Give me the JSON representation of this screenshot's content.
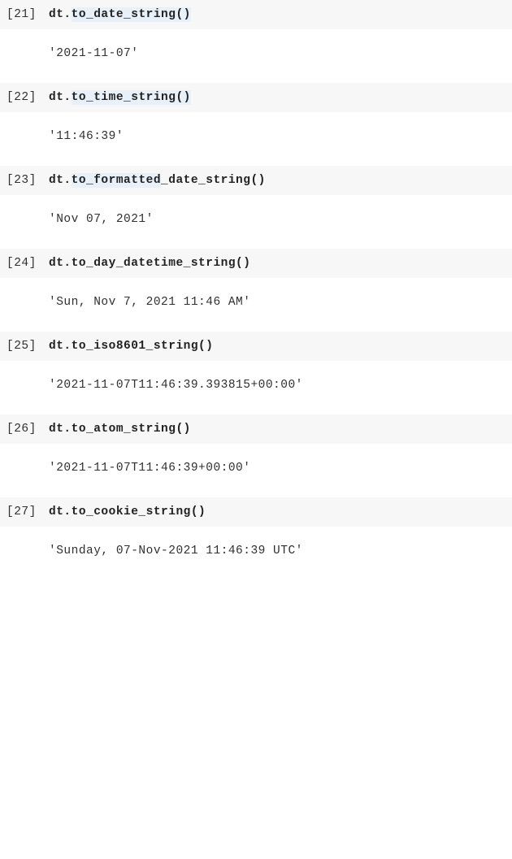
{
  "cells": [
    {
      "prompt": "[21] ",
      "code_prefix": "dt.",
      "code_highlight": "to_date_string()",
      "code_suffix": "",
      "output": "'2021-11-07'"
    },
    {
      "prompt": "[22] ",
      "code_prefix": "dt.",
      "code_highlight": "to_time_string()",
      "code_suffix": "",
      "output": "'11:46:39'"
    },
    {
      "prompt": "[23] ",
      "code_prefix": "dt.",
      "code_highlight": "to_formatted",
      "code_suffix": "_date_string()",
      "output": "'Nov 07, 2021'"
    },
    {
      "prompt": "[24] ",
      "code_prefix": "dt.to_day_datetime_string()",
      "code_highlight": "",
      "code_suffix": "",
      "output": "'Sun, Nov 7, 2021 11:46 AM'"
    },
    {
      "prompt": "[25] ",
      "code_prefix": "dt.to_iso8601_string()",
      "code_highlight": "",
      "code_suffix": "",
      "output": "'2021-11-07T11:46:39.393815+00:00'"
    },
    {
      "prompt": "[26] ",
      "code_prefix": "dt.to_atom_string()",
      "code_highlight": "",
      "code_suffix": "",
      "output": "'2021-11-07T11:46:39+00:00'"
    },
    {
      "prompt": "[27] ",
      "code_prefix": "dt.to_cookie_string()",
      "code_highlight": "",
      "code_suffix": "",
      "output": "'Sunday, 07-Nov-2021 11:46:39 UTC'"
    }
  ]
}
